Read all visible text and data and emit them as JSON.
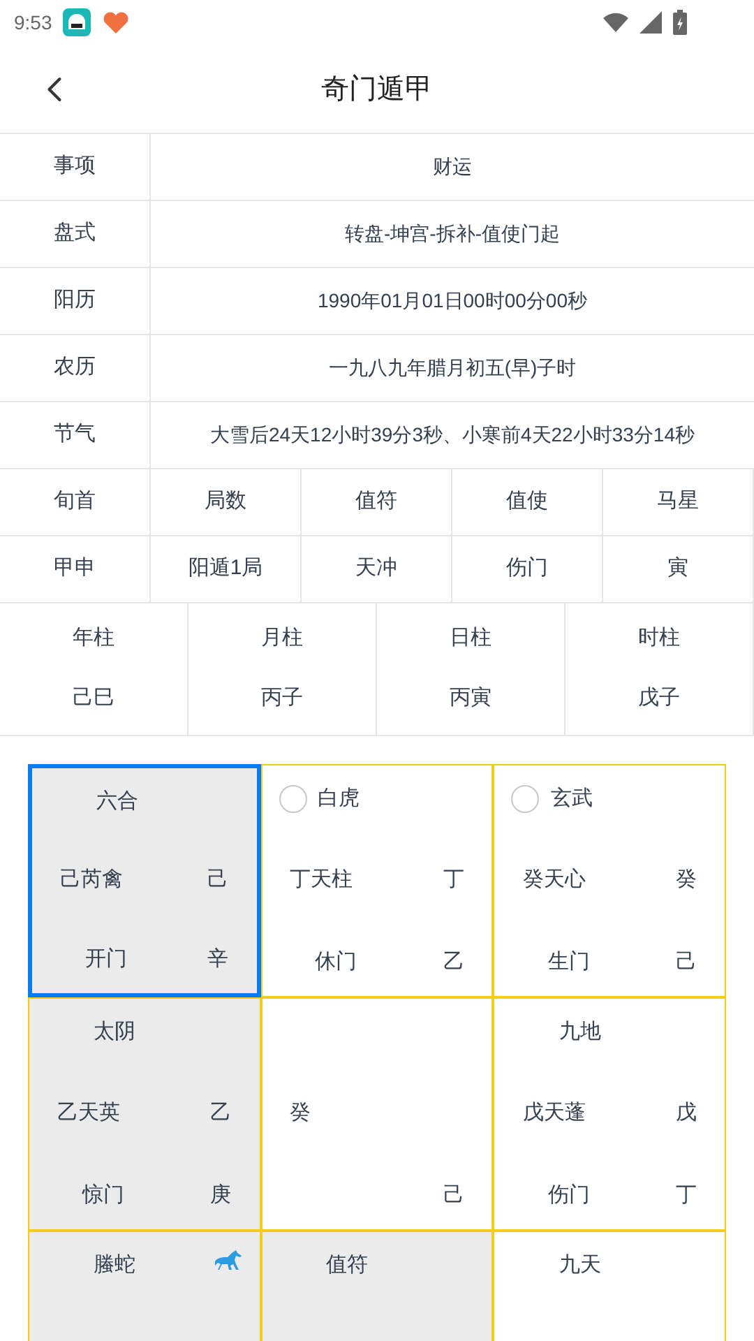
{
  "status_bar": {
    "time": "9:53"
  },
  "header": {
    "title": "奇门遁甲"
  },
  "info_rows": [
    {
      "label": "事项",
      "value": "财运"
    },
    {
      "label": "盘式",
      "value": "转盘-坤宫-拆补-值使门起"
    },
    {
      "label": "阳历",
      "value": "1990年01月01日00时00分00秒"
    },
    {
      "label": "农历",
      "value": "一九八九年腊月初五(早)子时"
    },
    {
      "label": "节气",
      "value": "大雪后24天12小时39分3秒、小寒前4天22小时33分14秒"
    }
  ],
  "summary": {
    "headers": [
      "旬首",
      "局数",
      "值符",
      "值使",
      "马星"
    ],
    "values": [
      "甲申",
      "阳遁1局",
      "天冲",
      "伤门",
      "寅"
    ]
  },
  "pillars": {
    "headers": [
      "年柱",
      "月柱",
      "日柱",
      "时柱"
    ],
    "values": [
      "己巳",
      "丙子",
      "丙寅",
      "戊子"
    ]
  },
  "palaces": [
    {
      "god": "六合",
      "ring": false,
      "horse": false,
      "shaded": true,
      "selected": true,
      "star": "己芮禽",
      "star_stem": "己",
      "door": "开门",
      "door_stem": "辛"
    },
    {
      "god": "白虎",
      "ring": true,
      "horse": false,
      "shaded": false,
      "selected": false,
      "star": "丁天柱",
      "star_stem": "丁",
      "door": "休门",
      "door_stem": "乙"
    },
    {
      "god": "玄武",
      "ring": true,
      "horse": false,
      "shaded": false,
      "selected": false,
      "star": "癸天心",
      "star_stem": "癸",
      "door": "生门",
      "door_stem": "己"
    },
    {
      "god": "太阴",
      "ring": false,
      "horse": false,
      "shaded": true,
      "selected": false,
      "star": "乙天英",
      "star_stem": "乙",
      "door": "惊门",
      "door_stem": "庚"
    },
    {
      "ring": false,
      "horse": false,
      "shaded": false,
      "selected": false,
      "star": "癸",
      "door_stem": "己"
    },
    {
      "god": "九地",
      "ring": false,
      "horse": false,
      "shaded": false,
      "selected": false,
      "star": "戊天蓬",
      "star_stem": "戊",
      "door": "伤门",
      "door_stem": "丁"
    },
    {
      "god": "螣蛇",
      "ring": false,
      "horse": true,
      "shaded": true,
      "selected": false
    },
    {
      "god": "值符",
      "ring": false,
      "horse": false,
      "shaded": true,
      "selected": false
    },
    {
      "god": "九天",
      "ring": false,
      "horse": false,
      "shaded": false,
      "selected": false
    }
  ]
}
